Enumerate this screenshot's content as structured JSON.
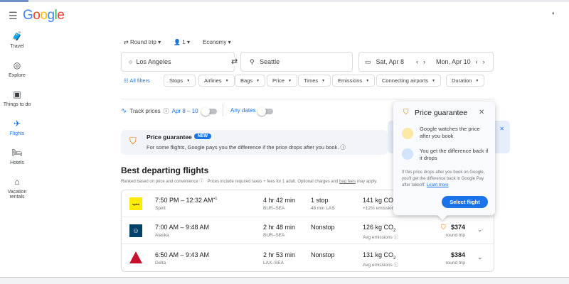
{
  "header": {
    "logo": "Google",
    "menu_icon": "menu-icon"
  },
  "sidebar": {
    "items": [
      {
        "label": "Travel",
        "icon": "🧳"
      },
      {
        "label": "Explore",
        "icon": "◎"
      },
      {
        "label": "Things to do",
        "icon": "▣"
      },
      {
        "label": "Flights",
        "icon": "✈"
      },
      {
        "label": "Hotels",
        "icon": "🛏"
      },
      {
        "label": "Vacation rentals",
        "icon": "⌂"
      }
    ]
  },
  "search": {
    "trip_type": "Round trip",
    "passengers": "1",
    "cabin": "Economy",
    "origin": "Los Angeles",
    "destination": "Seattle",
    "depart": "Sat, Apr 8",
    "return": "Mon, Apr 10"
  },
  "filters": {
    "all": "All filters",
    "chips": [
      "Stops",
      "Airlines",
      "Bags",
      "Price",
      "Times",
      "Emissions",
      "Connecting airports",
      "Duration"
    ]
  },
  "tracking": {
    "track_label": "Track prices",
    "dates": "Apr 8 – 10",
    "any_dates": "Any dates"
  },
  "banner": {
    "title": "Price guarantee",
    "badge": "NEW",
    "text": "For some flights, Google pays you the difference if the price drops after you book."
  },
  "results": {
    "title": "Best departing flights",
    "subtitle": "Ranked based on price and convenience",
    "note": "Prices include required taxes + fees for 1 adult. Optional charges and",
    "bag_fees": "bag fees",
    "note_end": "may apply."
  },
  "flights": [
    {
      "times": "7:50 PM – 12:32 AM",
      "plus": "+1",
      "airline": "Spirit",
      "duration": "4 hr 42 min",
      "route": "BUR–SEA",
      "stops": "1 stop",
      "stop_detail": "48 min LAS",
      "co2": "141 kg CO",
      "co2_note": "+12% emissions",
      "price": "",
      "price_note": "",
      "logo_color": "#ffec00"
    },
    {
      "times": "7:00 AM – 9:48 AM",
      "plus": "",
      "airline": "Alaska",
      "duration": "2 hr 48 min",
      "route": "BUR–SEA",
      "stops": "Nonstop",
      "stop_detail": "",
      "co2": "126 kg CO",
      "co2_note": "Avg emissions",
      "price": "$374",
      "price_note": "round trip",
      "logo_color": "#01426a"
    },
    {
      "times": "6:50 AM – 9:43 AM",
      "plus": "",
      "airline": "Delta",
      "duration": "2 hr 53 min",
      "route": "LAX–SEA",
      "stops": "Nonstop",
      "stop_detail": "",
      "co2": "131 kg CO",
      "co2_note": "Avg emissions",
      "price": "$384",
      "price_note": "round trip",
      "logo_color": "#c8102e"
    }
  ],
  "popover": {
    "title": "Price guarantee",
    "item1": "Google watches the price after you book",
    "item2": "You get the difference back if it drops",
    "body": "If this price drops after you book on Google, you'll get the difference back in Google Pay after takeoff.",
    "learn_more": "Learn more",
    "button": "Select flight"
  },
  "colors": {
    "accent": "#1a73e8"
  }
}
